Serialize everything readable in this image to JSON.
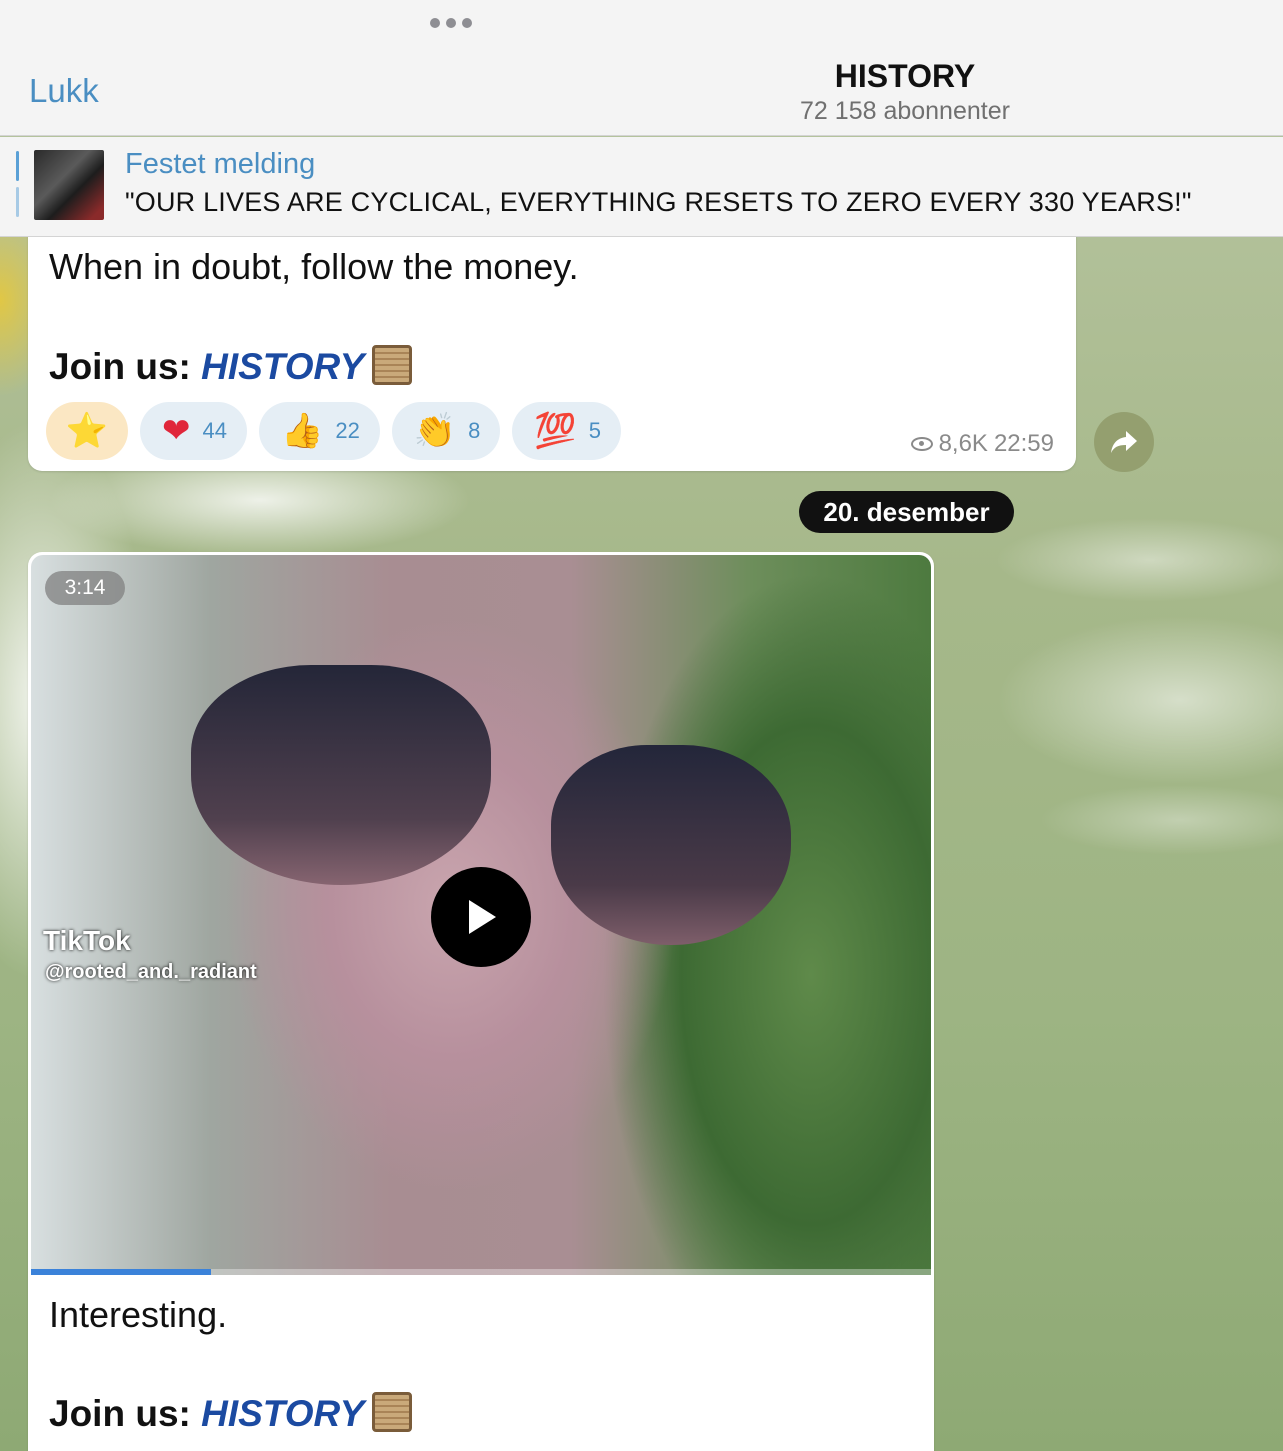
{
  "header": {
    "close_label": "Lukk",
    "title": "HISTORY",
    "subscribers": "72 158 abonnenter"
  },
  "pinned": {
    "label": "Festet melding",
    "text": "\"OUR LIVES ARE CYCLICAL, EVERYTHING RESETS TO ZERO EVERY 330 YEARS!\""
  },
  "message1": {
    "text": "When in doubt, follow the money.",
    "join_prefix": "Join us: ",
    "join_link": "HISTORY",
    "reactions": [
      {
        "emoji": "⭐",
        "count": ""
      },
      {
        "emoji": "❤",
        "count": "44"
      },
      {
        "emoji": "👍",
        "count": "22"
      },
      {
        "emoji": "👏",
        "count": "8"
      },
      {
        "emoji": "💯",
        "count": "5"
      }
    ],
    "views": "8,6K",
    "time": "22:59"
  },
  "date_separator": "20. desember",
  "message2": {
    "duration": "3:14",
    "video_overlay_brand": "TikTok",
    "video_overlay_user": "@rooted_and._radiant",
    "progress": 0.2,
    "text": "Interesting.",
    "join_prefix": "Join us: ",
    "join_link": "HISTORY"
  },
  "colors": {
    "accent": "#4a8ec2",
    "link": "#1b4aa1",
    "reaction_bg": "#e5eef5"
  }
}
